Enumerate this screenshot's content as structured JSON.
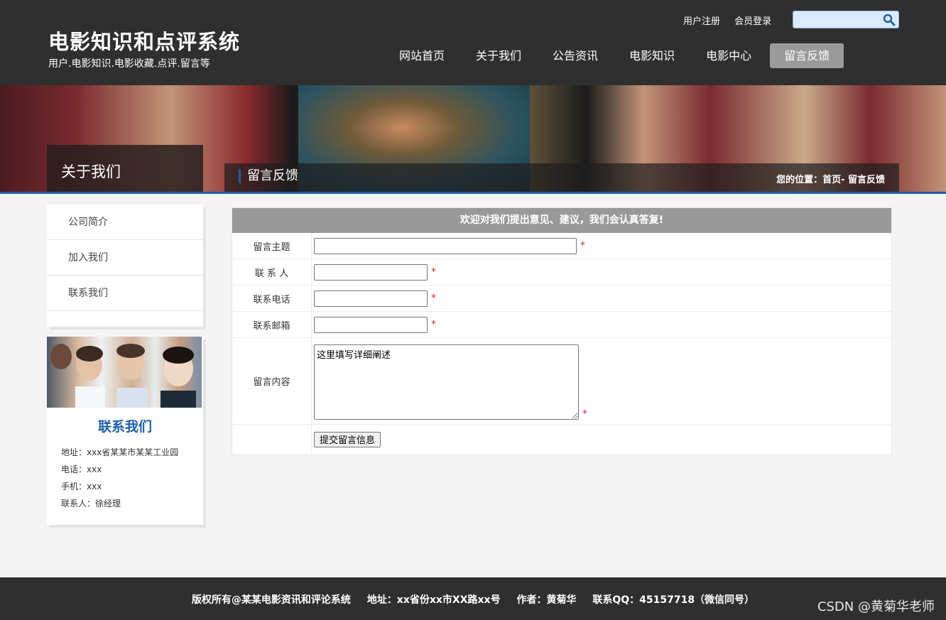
{
  "header": {
    "site_title": "电影知识和点评系统",
    "site_subtitle": "用户.电影知识.电影收藏.点评.留言等",
    "top_links": {
      "register": "用户注册",
      "login": "会员登录"
    },
    "nav": [
      "网站首页",
      "关于我们",
      "公告资讯",
      "电影知识",
      "电影中心",
      "留言反馈"
    ],
    "nav_active": "留言反馈"
  },
  "banner": {
    "section_title": "关于我们",
    "page_title": "留言反馈",
    "location": "您的位置：首页- 留言反馈"
  },
  "sidebar": {
    "menu": [
      "公司简介",
      "加入我们",
      "联系我们"
    ],
    "contact": {
      "title": "联系我们",
      "address": "地址：xxx省某某市某某工业园",
      "phone": "电话：xxx",
      "mobile": "手机：xxx",
      "person": "联系人：徐经理"
    }
  },
  "form": {
    "heading": "欢迎对我们提出意见、建议，我们会认真答复!",
    "subject_label": "留言主题",
    "contact_label": "联 系 人",
    "phone_label": "联系电话",
    "email_label": "联系邮箱",
    "content_label": "留言内容",
    "content_value": "这里填写详细阐述",
    "required_mark": "*",
    "submit_label": "提交留言信息"
  },
  "footer": {
    "copyright": "版权所有@某某电影资讯和评论系统",
    "address": "地址：xx省份xx市XX路xx号",
    "author": "作者：黄菊华",
    "qq": "联系QQ：45157718（微信同号）"
  },
  "watermark": "CSDN @黄菊华老师",
  "colors": {
    "header_bg": "#2f2f2f",
    "accent": "#1e5fa8",
    "required": "#e02b2b"
  }
}
